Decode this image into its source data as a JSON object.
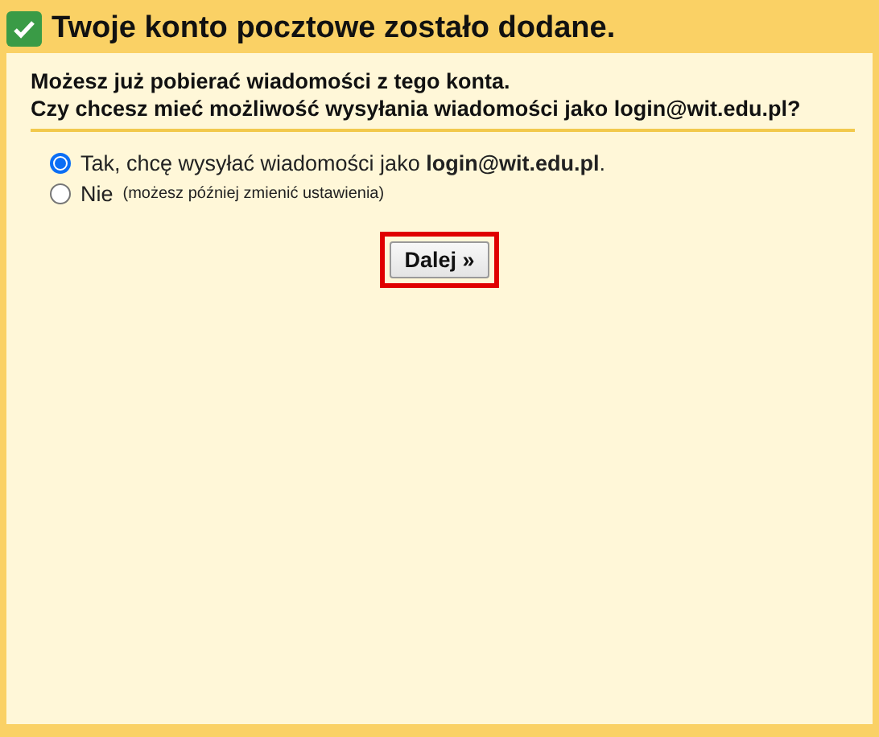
{
  "header": {
    "title": "Twoje konto pocztowe zostało dodane.",
    "checked": true
  },
  "intro": [
    "Możesz już pobierać wiadomości z tego konta.",
    "Czy chcesz mieć możliwość wysyłania wiadomości jako login@wit.edu.pl?"
  ],
  "options": [
    {
      "label": "Tak, chcę wysyłać wiadomości jako **login@wit.edu.pl**.",
      "selected": true
    },
    {
      "label": "Nie",
      "note": "(możesz później zmienić ustawienia)",
      "selected": false
    }
  ],
  "next_button": {
    "label": "Dalej »",
    "highlighted": true
  }
}
